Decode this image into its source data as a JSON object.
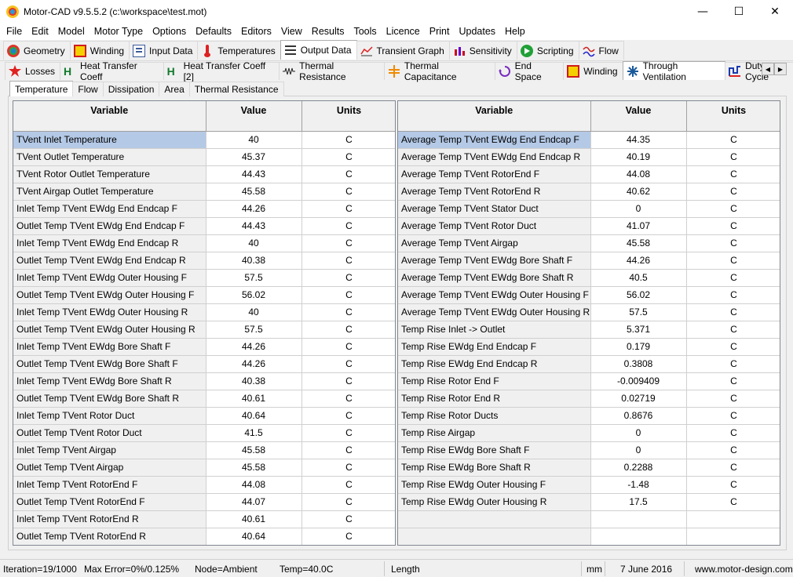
{
  "window": {
    "title": "Motor-CAD v9.5.5.2 (c:\\workspace\\test.mot)",
    "minimize": "—",
    "maximize": "☐",
    "close": "✕"
  },
  "menu": [
    "File",
    "Edit",
    "Model",
    "Motor Type",
    "Options",
    "Defaults",
    "Editors",
    "View",
    "Results",
    "Tools",
    "Licence",
    "Print",
    "Updates",
    "Help"
  ],
  "main_tabs": [
    "Geometry",
    "Winding",
    "Input Data",
    "Temperatures",
    "Output Data",
    "Transient Graph",
    "Sensitivity",
    "Scripting",
    "Flow"
  ],
  "sub_tabs": [
    "Losses",
    "Heat Transfer Coeff",
    "Heat Transfer Coeff [2]",
    "Thermal Resistance",
    "Thermal Capacitance",
    "End Space",
    "Winding",
    "Through Ventilation",
    "Duty Cycle"
  ],
  "inner_tabs": [
    "Temperature",
    "Flow",
    "Dissipation",
    "Area",
    "Thermal Resistance"
  ],
  "scroll": {
    "left": "◀",
    "right": "▶"
  },
  "headers": {
    "variable": "Variable",
    "value": "Value",
    "units": "Units"
  },
  "left_rows": [
    [
      "TVent Inlet Temperature",
      "40",
      "C"
    ],
    [
      "TVent Outlet Temperature",
      "45.37",
      "C"
    ],
    [
      "TVent Rotor Outlet Temperature",
      "44.43",
      "C"
    ],
    [
      "TVent Airgap Outlet Temperature",
      "45.58",
      "C"
    ],
    [
      "Inlet Temp TVent EWdg End Endcap F",
      "44.26",
      "C"
    ],
    [
      "Outlet Temp TVent EWdg End Endcap F",
      "44.43",
      "C"
    ],
    [
      "Inlet Temp TVent EWdg End Endcap R",
      "40",
      "C"
    ],
    [
      "Outlet Temp TVent EWdg End Endcap R",
      "40.38",
      "C"
    ],
    [
      "Inlet Temp TVent EWdg Outer Housing F",
      "57.5",
      "C"
    ],
    [
      "Outlet Temp TVent EWdg Outer Housing F",
      "56.02",
      "C"
    ],
    [
      "Inlet Temp TVent EWdg Outer Housing R",
      "40",
      "C"
    ],
    [
      "Outlet Temp TVent EWdg Outer Housing R",
      "57.5",
      "C"
    ],
    [
      "Inlet Temp TVent EWdg Bore Shaft F",
      "44.26",
      "C"
    ],
    [
      "Outlet Temp TVent EWdg Bore Shaft F",
      "44.26",
      "C"
    ],
    [
      "Inlet Temp TVent EWdg Bore Shaft R",
      "40.38",
      "C"
    ],
    [
      "Outlet Temp TVent EWdg Bore Shaft R",
      "40.61",
      "C"
    ],
    [
      "Inlet Temp TVent Rotor Duct",
      "40.64",
      "C"
    ],
    [
      "Outlet Temp TVent Rotor Duct",
      "41.5",
      "C"
    ],
    [
      "Inlet Temp TVent Airgap",
      "45.58",
      "C"
    ],
    [
      "Outlet Temp TVent Airgap",
      "45.58",
      "C"
    ],
    [
      "Inlet Temp TVent RotorEnd F",
      "44.08",
      "C"
    ],
    [
      "Outlet Temp TVent RotorEnd F",
      "44.07",
      "C"
    ],
    [
      "Inlet Temp TVent RotorEnd R",
      "40.61",
      "C"
    ],
    [
      "Outlet Temp TVent RotorEnd R",
      "40.64",
      "C"
    ]
  ],
  "right_rows": [
    [
      "Average Temp TVent EWdg End Endcap F",
      "44.35",
      "C"
    ],
    [
      "Average Temp TVent EWdg End Endcap R",
      "40.19",
      "C"
    ],
    [
      "Average Temp TVent RotorEnd F",
      "44.08",
      "C"
    ],
    [
      "Average Temp TVent RotorEnd R",
      "40.62",
      "C"
    ],
    [
      "Average Temp TVent Stator Duct",
      "0",
      "C"
    ],
    [
      "Average Temp TVent Rotor Duct",
      "41.07",
      "C"
    ],
    [
      "Average Temp TVent Airgap",
      "45.58",
      "C"
    ],
    [
      "Average Temp TVent EWdg Bore Shaft F",
      "44.26",
      "C"
    ],
    [
      "Average Temp TVent EWdg Bore Shaft R",
      "40.5",
      "C"
    ],
    [
      "Average Temp TVent EWdg Outer Housing F",
      "56.02",
      "C"
    ],
    [
      "Average Temp TVent EWdg Outer Housing R",
      "57.5",
      "C"
    ],
    [
      "Temp Rise Inlet -> Outlet",
      "5.371",
      "C"
    ],
    [
      "Temp Rise EWdg End Endcap F",
      "0.179",
      "C"
    ],
    [
      "Temp Rise EWdg End Endcap R",
      "0.3808",
      "C"
    ],
    [
      "Temp Rise Rotor End F",
      "-0.009409",
      "C"
    ],
    [
      "Temp Rise Rotor End R",
      "0.02719",
      "C"
    ],
    [
      "Temp Rise Rotor Ducts",
      "0.8676",
      "C"
    ],
    [
      "Temp Rise Airgap",
      "0",
      "C"
    ],
    [
      "Temp Rise EWdg Bore Shaft F",
      "0",
      "C"
    ],
    [
      "Temp Rise EWdg Bore Shaft R",
      "0.2288",
      "C"
    ],
    [
      "Temp Rise EWdg Outer Housing F",
      "-1.48",
      "C"
    ],
    [
      "Temp Rise EWdg Outer Housing R",
      "17.5",
      "C"
    ],
    [
      "",
      "",
      ""
    ],
    [
      "",
      "",
      ""
    ]
  ],
  "status": {
    "iteration": "Iteration=19/1000",
    "max_error": "Max Error=0%/0.125%",
    "node": "Node=Ambient",
    "temp": "Temp=40.0C",
    "length": "Length",
    "units": "mm",
    "date": "7 June 2016",
    "site": "www.motor-design.com"
  },
  "colors": {
    "selection": "#b4c9e6",
    "header": "#f0f0f0"
  }
}
